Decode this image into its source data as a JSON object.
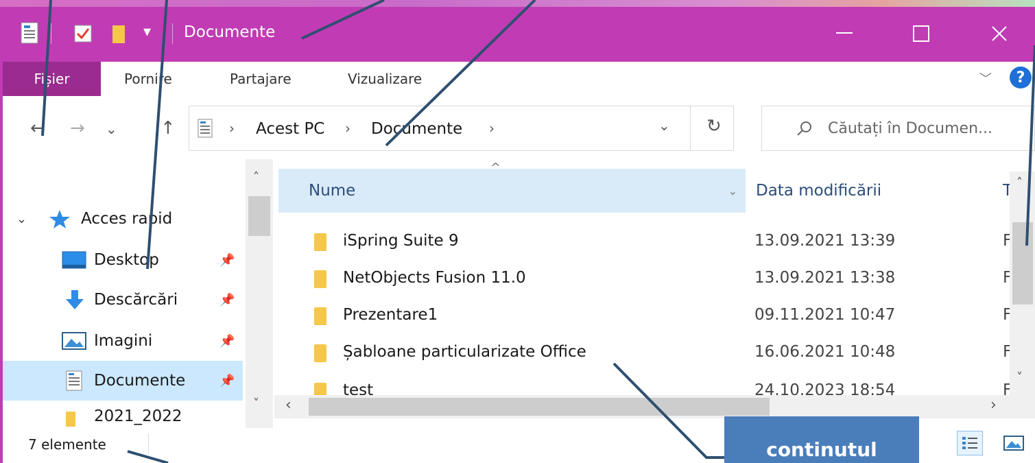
{
  "window": {
    "title": "Documente",
    "qat_dropdown": "▾"
  },
  "ribbon": {
    "tabs": [
      "Fișier",
      "Pornire",
      "Partajare",
      "Vizualizare"
    ],
    "collapse_glyph": "﹀",
    "help": "?"
  },
  "address_bar": {
    "crumbs": [
      "Acest PC",
      "Documente"
    ],
    "separator": "›",
    "dropdown": "⌄",
    "refresh": "↻"
  },
  "search": {
    "placeholder": "Căutați în Documen..."
  },
  "navigation": {
    "back": "←",
    "forward": "→",
    "recent": "⌄",
    "up": "↑"
  },
  "nav_pane": {
    "quick_access_label": "Acces rapid",
    "items": [
      {
        "label": "Desktop",
        "icon": "desktop-icon",
        "pinned": true,
        "selected": false
      },
      {
        "label": "Descărcări",
        "icon": "download-arrow-icon",
        "pinned": true,
        "selected": false
      },
      {
        "label": "Imagini",
        "icon": "pictures-icon",
        "pinned": true,
        "selected": false
      },
      {
        "label": "Documente",
        "icon": "documents-icon",
        "pinned": true,
        "selected": true
      },
      {
        "label": "2021_2022",
        "icon": "folder-icon",
        "pinned": false,
        "selected": false
      }
    ]
  },
  "file_list": {
    "columns": {
      "name": "Nume",
      "date": "Data modificării",
      "type_partial": "T"
    },
    "rows": [
      {
        "name": "iSpring Suite 9",
        "date": "13.09.2021 13:39",
        "type": "F"
      },
      {
        "name": "NetObjects Fusion 11.0",
        "date": "13.09.2021 13:38",
        "type": "F"
      },
      {
        "name": "Prezentare1",
        "date": "09.11.2021 10:47",
        "type": "F"
      },
      {
        "name": "Șabloane particularizate Office",
        "date": "16.06.2021 10:48",
        "type": "F"
      },
      {
        "name": "test",
        "date": "24.10.2023 18:54",
        "type": "F"
      }
    ]
  },
  "status_bar": {
    "item_count": "7 elemente"
  },
  "callout": {
    "text": "continutul"
  },
  "colors": {
    "titlebar": "#c13bb5",
    "file_tab": "#9b2b8f",
    "selection": "#cce8ff",
    "callout": "#4a7ebb",
    "annotation_line": "#2f4f6f"
  }
}
